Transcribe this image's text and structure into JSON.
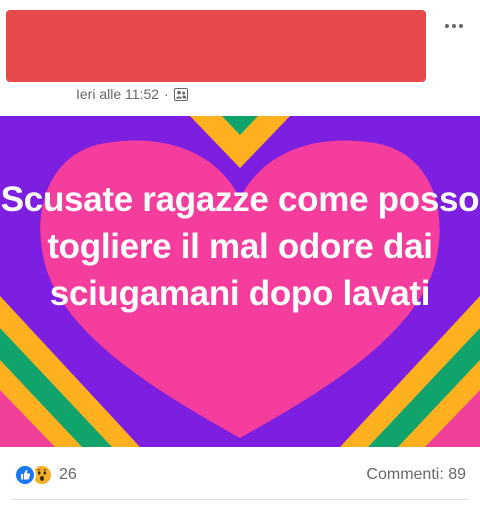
{
  "post": {
    "timestamp": "Ieri alle 11:52",
    "separator": "·",
    "audience_icon": "friends-icon",
    "more_icon": "more-horizontal-icon"
  },
  "image": {
    "text": "Scusate ragazze come posso togliere il mal odore dai sciugamani dopo lavati",
    "colors": {
      "background": "#7d1fe0",
      "heart": "#f43d9d",
      "stripe_orange": "#ffb01f",
      "stripe_green": "#10a36b",
      "stripe_pink": "#f0409a",
      "text": "#ffffff"
    }
  },
  "footer": {
    "reaction_icons": [
      "like-icon",
      "wow-icon"
    ],
    "reaction_count": "26",
    "comments_label": "Commenti: 89"
  }
}
